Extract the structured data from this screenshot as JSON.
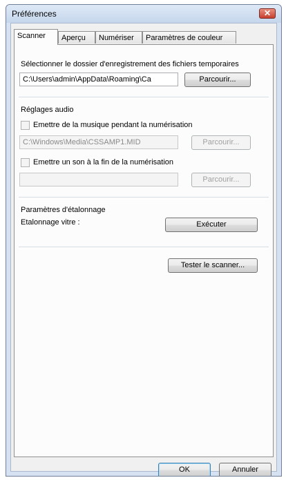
{
  "window": {
    "title": "Préférences",
    "close_glyph": "✕"
  },
  "tabs": [
    {
      "label": "Scanner",
      "active": true
    },
    {
      "label": "Aperçu",
      "active": false
    },
    {
      "label": "Numériser",
      "active": false
    },
    {
      "label": "Paramètres de couleur",
      "active": false
    }
  ],
  "temp_folder": {
    "label": "Sélectionner le dossier d'enregistrement des fichiers temporaires",
    "value": "C:\\Users\\admin\\AppData\\Roaming\\Ca",
    "browse_label": "Parcourir..."
  },
  "audio": {
    "heading": "Réglages audio",
    "music_checkbox_label": "Emettre de la musique pendant la numérisation",
    "music_checked": false,
    "music_file": "C:\\Windows\\Media\\CSSAMP1.MID",
    "music_browse_label": "Parcourir...",
    "end_sound_checkbox_label": "Emettre un son à la fin de la numérisation",
    "end_sound_checked": false,
    "end_sound_file": "",
    "end_browse_label": "Parcourir..."
  },
  "calibration": {
    "heading": "Paramètres d'étalonnage",
    "glass_label": "Etalonnage vitre :",
    "run_label": "Exécuter"
  },
  "test_scanner_label": "Tester le scanner...",
  "footer": {
    "ok_label": "OK",
    "cancel_label": "Annuler"
  }
}
